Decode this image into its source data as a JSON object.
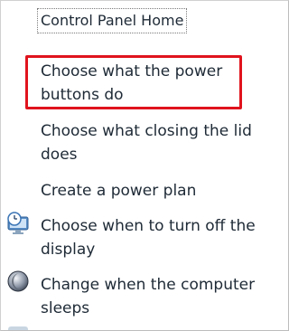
{
  "nav": {
    "home_label": "Control Panel Home"
  },
  "tasks": [
    {
      "label": "Choose what the power buttons do",
      "icon": null,
      "highlighted": true
    },
    {
      "label": "Choose what closing the lid does",
      "icon": null
    },
    {
      "label": "Create a power plan",
      "icon": null
    },
    {
      "label": "Choose when to turn off the display",
      "icon": "display-clock-icon"
    },
    {
      "label": "Change when the computer sleeps",
      "icon": "moon-sleep-icon"
    }
  ],
  "colors": {
    "highlight": "#e0131d",
    "text": "#1e2a36"
  }
}
